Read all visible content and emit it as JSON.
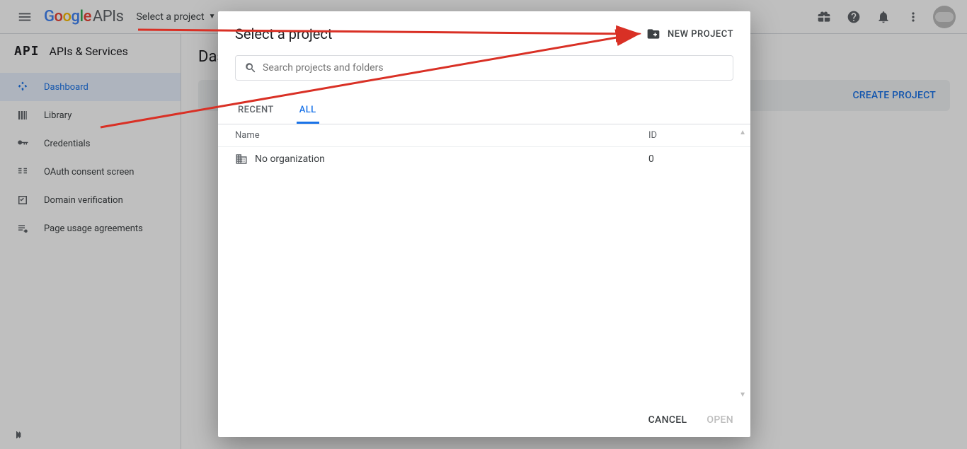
{
  "header": {
    "logo_suffix": "APIs",
    "project_selector_label": "Select a project"
  },
  "sidebar": {
    "title": "APIs & Services",
    "badge": "API",
    "items": [
      {
        "icon": "dashboard",
        "label": "Dashboard",
        "active": true
      },
      {
        "icon": "library",
        "label": "Library"
      },
      {
        "icon": "key",
        "label": "Credentials"
      },
      {
        "icon": "consent",
        "label": "OAuth consent screen"
      },
      {
        "icon": "domain",
        "label": "Domain verification"
      },
      {
        "icon": "agreement",
        "label": "Page usage agreements"
      }
    ]
  },
  "content": {
    "title_visible": "Das",
    "banner_button": "CREATE PROJECT"
  },
  "dialog": {
    "title": "Select a project",
    "new_project_label": "NEW PROJECT",
    "search_placeholder": "Search projects and folders",
    "tabs": [
      {
        "label": "RECENT"
      },
      {
        "label": "ALL",
        "active": true
      }
    ],
    "columns": {
      "name": "Name",
      "id": "ID"
    },
    "rows": [
      {
        "name": "No organization",
        "id": "0"
      }
    ],
    "footer": {
      "cancel": "CANCEL",
      "open": "OPEN"
    }
  }
}
